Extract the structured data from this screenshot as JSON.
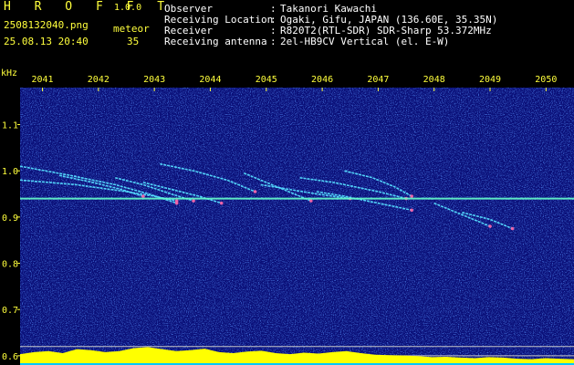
{
  "header": {
    "app_title": "H R O F F T",
    "app_version": "1.0.0",
    "file_name": "2508132040.png",
    "timestamp": "25.08.13 20:40",
    "count_label": "meteor",
    "count_value": "35",
    "info": [
      {
        "key": "Observer",
        "value": "Takanori Kawachi"
      },
      {
        "key": "Receiving Location",
        "value": "Ogaki, Gifu, JAPAN (136.60E, 35.35N)"
      },
      {
        "key": "Receiver",
        "value": "R820T2(RTL-SDR) SDR-Sharp 53.372MHz"
      },
      {
        "key": "Receiving antenna",
        "value": "2el-HB9CV Vertical (el. E-W)"
      }
    ]
  },
  "colors": {
    "background": "#000000",
    "spectrogram_base": "#0a0f78",
    "header_text": "#ffff3c",
    "info_text": "#ffffff",
    "axis_text": "#ffff3c",
    "carrier": "#66ffcc",
    "meteor_trail": "#55ddff",
    "meteor_hot": "#ff66aa",
    "reference_line": "#c8c8c8",
    "level_bar": "#ffff00",
    "level_floor": "#00c8ff"
  },
  "chart_data": {
    "type": "heatmap",
    "ylabel": "kHz",
    "x_ticks": [
      "2041",
      "2042",
      "2043",
      "2044",
      "2045",
      "2046",
      "2047",
      "2048",
      "2049",
      "2050"
    ],
    "y_ticks": [
      "1.1",
      "1.0",
      "0.9",
      "0.8",
      "0.7",
      "0.6"
    ],
    "y_tick_values": [
      1.1,
      1.0,
      0.9,
      0.8,
      0.7,
      0.6
    ],
    "ylim": [
      0.58,
      1.18
    ],
    "xlim": [
      2040.6,
      2050.5
    ],
    "carrier_khz": 0.94,
    "reference_khz": [
      0.62,
      0.6
    ],
    "meteor_echoes": [
      {
        "x": [
          2040.6,
          2041.5,
          2042.3,
          2042.9,
          2043.4
        ],
        "y": [
          1.01,
          0.99,
          0.97,
          0.95,
          0.93
        ]
      },
      {
        "x": [
          2040.6,
          2041.6,
          2042.5,
          2043.0,
          2043.4
        ],
        "y": [
          0.98,
          0.97,
          0.955,
          0.945,
          0.935
        ]
      },
      {
        "x": [
          2041.3,
          2041.9,
          2042.4,
          2042.8
        ],
        "y": [
          0.99,
          0.975,
          0.96,
          0.945
        ]
      },
      {
        "x": [
          2042.3,
          2042.8,
          2043.3,
          2043.7
        ],
        "y": [
          0.985,
          0.97,
          0.95,
          0.935
        ]
      },
      {
        "x": [
          2042.8,
          2043.3,
          2043.8,
          2044.2
        ],
        "y": [
          0.975,
          0.96,
          0.945,
          0.93
        ]
      },
      {
        "x": [
          2043.1,
          2043.7,
          2044.3,
          2044.8
        ],
        "y": [
          1.015,
          1.0,
          0.98,
          0.955
        ]
      },
      {
        "x": [
          2044.6,
          2045.0,
          2045.4,
          2045.8
        ],
        "y": [
          0.995,
          0.975,
          0.955,
          0.935
        ]
      },
      {
        "x": [
          2044.9,
          2045.4,
          2045.9,
          2046.5
        ],
        "y": [
          0.97,
          0.96,
          0.95,
          0.94
        ]
      },
      {
        "x": [
          2045.6,
          2046.2,
          2046.6,
          2047.0,
          2047.5
        ],
        "y": [
          0.985,
          0.975,
          0.965,
          0.955,
          0.94
        ]
      },
      {
        "x": [
          2046.4,
          2046.9,
          2047.3,
          2047.6
        ],
        "y": [
          1.0,
          0.985,
          0.965,
          0.945
        ]
      },
      {
        "x": [
          2045.9,
          2046.4,
          2046.8,
          2047.2,
          2047.6
        ],
        "y": [
          0.955,
          0.945,
          0.935,
          0.925,
          0.915
        ]
      },
      {
        "x": [
          2048.0,
          2048.6,
          2049.0
        ],
        "y": [
          0.93,
          0.9,
          0.88
        ]
      },
      {
        "x": [
          2048.5,
          2049.0,
          2049.4
        ],
        "y": [
          0.91,
          0.895,
          0.875
        ]
      }
    ],
    "level_profile": [
      0.45,
      0.55,
      0.6,
      0.5,
      0.7,
      0.65,
      0.55,
      0.6,
      0.75,
      0.8,
      0.7,
      0.6,
      0.65,
      0.72,
      0.55,
      0.5,
      0.58,
      0.62,
      0.5,
      0.45,
      0.52,
      0.48,
      0.55,
      0.6,
      0.5,
      0.42,
      0.4,
      0.38,
      0.35,
      0.3,
      0.32,
      0.28,
      0.25,
      0.3,
      0.28,
      0.22,
      0.2,
      0.25,
      0.22,
      0.2
    ]
  }
}
